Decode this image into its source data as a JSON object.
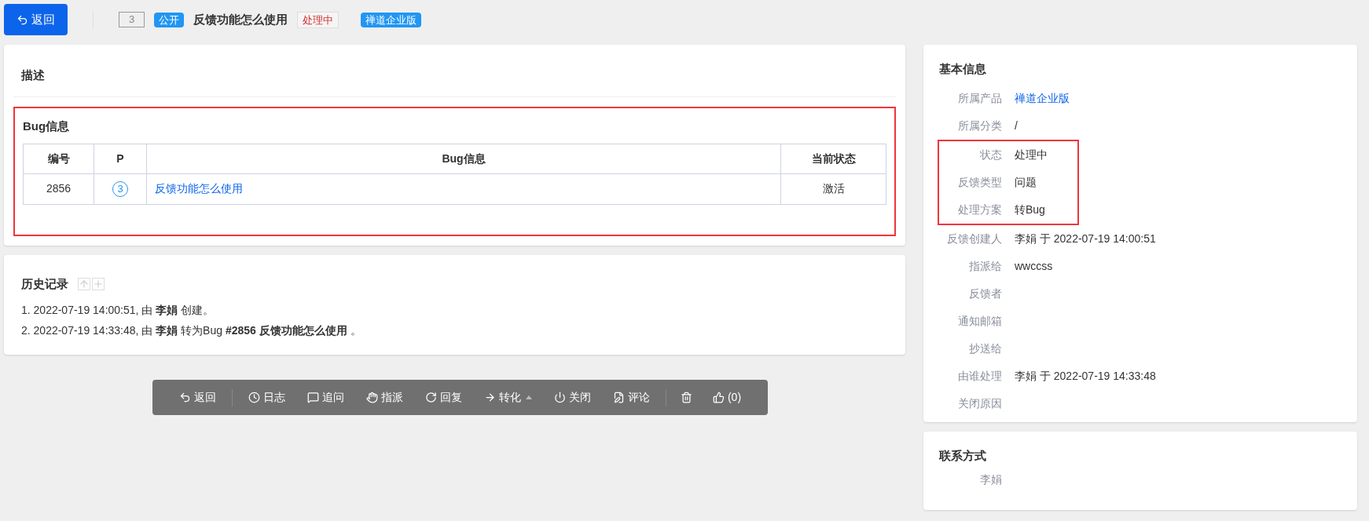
{
  "header": {
    "back_button": "返回",
    "id": "3",
    "visibility": "公开",
    "title": "反馈功能怎么使用",
    "status": "处理中",
    "product": "禅道企业版"
  },
  "description": {
    "title": "描述"
  },
  "bug_info": {
    "highlighted": true,
    "title": "Bug信息",
    "columns": [
      "编号",
      "P",
      "Bug信息",
      "当前状态"
    ],
    "rows": [
      {
        "id": "2856",
        "priority": "3",
        "title": "反馈功能怎么使用",
        "status": "激活"
      }
    ]
  },
  "history": {
    "title": "历史记录",
    "entries": [
      "1. 2022-07-19 14:00:51, 由 **李娟** 创建。",
      "2. 2022-07-19 14:33:48, 由 **李娟** 转为Bug **#2856 反馈功能怎么使用** 。"
    ]
  },
  "toolbar": {
    "groups": [
      {
        "items": [
          {
            "label": "返回"
          }
        ]
      },
      {
        "items": [
          {
            "label": "日志"
          },
          {
            "label": "追问"
          },
          {
            "label": "指派"
          },
          {
            "label": "回复"
          },
          {
            "label": "转化",
            "dropdown": true
          },
          {
            "label": "关闭"
          },
          {
            "label": "评论"
          }
        ]
      },
      {
        "items": [
          {
            "kind": "icon"
          },
          {
            "label": "(0)"
          }
        ]
      }
    ]
  },
  "basic_info": {
    "title": "基本信息",
    "sections": [
      {
        "highlighted": false,
        "rows": [
          {
            "label": "所属产品",
            "value": "禅道企业版",
            "link": true
          },
          {
            "label": "所属分类",
            "value": "/",
            "link": false
          }
        ]
      },
      {
        "highlighted": true,
        "rows": [
          {
            "label": "状态",
            "value": "处理中",
            "link": false
          },
          {
            "label": "反馈类型",
            "value": "问题",
            "link": false
          },
          {
            "label": "处理方案",
            "value": "转Bug",
            "link": false
          }
        ]
      },
      {
        "highlighted": false,
        "rows": [
          {
            "label": "反馈创建人",
            "value": "李娟 于 2022-07-19 14:00:51",
            "link": false
          },
          {
            "label": "指派给",
            "value": "wwccss",
            "link": false
          },
          {
            "label": "反馈者"
          },
          {
            "label": "通知邮箱"
          },
          {
            "label": "抄送给"
          },
          {
            "label": "由谁处理",
            "value": "李娟 于 2022-07-19 14:33:48",
            "link": false
          },
          {
            "label": "关闭原因"
          }
        ]
      }
    ]
  },
  "contact": {
    "title": "联系方式",
    "name": "李娟"
  }
}
